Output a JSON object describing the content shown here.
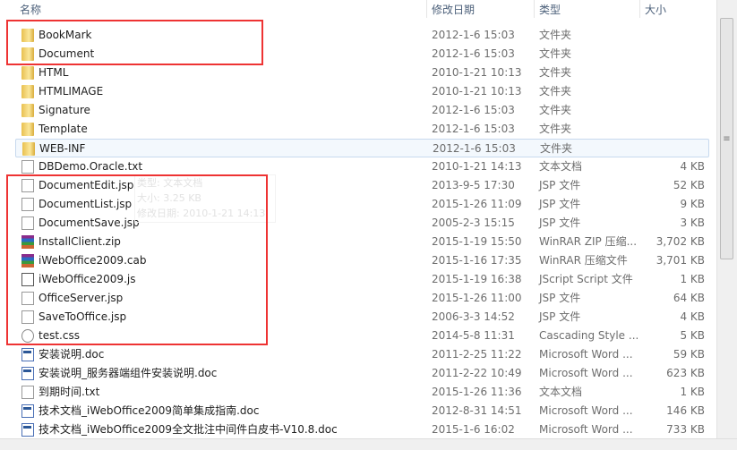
{
  "columns": {
    "name": "名称",
    "date": "修改日期",
    "type": "类型",
    "size": "大小"
  },
  "tooltip": {
    "type": "类型: 文本文档",
    "size": "大小: 3.25 KB",
    "date": "修改日期: 2010-1-21 14:13"
  },
  "highlight_color": "#ee3333",
  "files": [
    {
      "icon": "folder",
      "name": "BookMark",
      "date": "2012-1-6 15:03",
      "type": "文件夹",
      "size": ""
    },
    {
      "icon": "folder",
      "name": "Document",
      "date": "2012-1-6 15:03",
      "type": "文件夹",
      "size": ""
    },
    {
      "icon": "folder",
      "name": "HTML",
      "date": "2010-1-21 10:13",
      "type": "文件夹",
      "size": ""
    },
    {
      "icon": "folder",
      "name": "HTMLIMAGE",
      "date": "2010-1-21 10:13",
      "type": "文件夹",
      "size": ""
    },
    {
      "icon": "folder",
      "name": "Signature",
      "date": "2012-1-6 15:03",
      "type": "文件夹",
      "size": ""
    },
    {
      "icon": "folder",
      "name": "Template",
      "date": "2012-1-6 15:03",
      "type": "文件夹",
      "size": ""
    },
    {
      "icon": "folder",
      "name": "WEB-INF",
      "date": "2012-1-6 15:03",
      "type": "文件夹",
      "size": "",
      "selected": true
    },
    {
      "icon": "file",
      "name": "DBDemo.Oracle.txt",
      "date": "2010-1-21 14:13",
      "type": "文本文档",
      "size": "4 KB"
    },
    {
      "icon": "file",
      "name": "DocumentEdit.jsp",
      "date": "2013-9-5 17:30",
      "type": "JSP 文件",
      "size": "52 KB"
    },
    {
      "icon": "file",
      "name": "DocumentList.jsp",
      "date": "2015-1-26 11:09",
      "type": "JSP 文件",
      "size": "9 KB"
    },
    {
      "icon": "file",
      "name": "DocumentSave.jsp",
      "date": "2005-2-3 15:15",
      "type": "JSP 文件",
      "size": "3 KB"
    },
    {
      "icon": "zip",
      "name": "InstallClient.zip",
      "date": "2015-1-19 15:50",
      "type": "WinRAR ZIP 压缩...",
      "size": "3,702 KB"
    },
    {
      "icon": "zip",
      "name": "iWebOffice2009.cab",
      "date": "2015-1-16 17:35",
      "type": "WinRAR 压缩文件",
      "size": "3,701 KB"
    },
    {
      "icon": "js",
      "name": "iWebOffice2009.js",
      "date": "2015-1-19 16:38",
      "type": "JScript Script 文件",
      "size": "1 KB"
    },
    {
      "icon": "file",
      "name": "OfficeServer.jsp",
      "date": "2015-1-26 11:00",
      "type": "JSP 文件",
      "size": "64 KB"
    },
    {
      "icon": "file",
      "name": "SaveToOffice.jsp",
      "date": "2006-3-3 14:52",
      "type": "JSP 文件",
      "size": "4 KB"
    },
    {
      "icon": "css",
      "name": "test.css",
      "date": "2014-5-8 11:31",
      "type": "Cascading Style ...",
      "size": "5 KB"
    },
    {
      "icon": "doc",
      "name": "安装说明.doc",
      "date": "2011-2-25 11:22",
      "type": "Microsoft Word ...",
      "size": "59 KB"
    },
    {
      "icon": "doc",
      "name": "安装说明_服务器端组件安装说明.doc",
      "date": "2011-2-22 10:49",
      "type": "Microsoft Word ...",
      "size": "623 KB"
    },
    {
      "icon": "file",
      "name": "到期时间.txt",
      "date": "2015-1-26 11:36",
      "type": "文本文档",
      "size": "1 KB"
    },
    {
      "icon": "doc",
      "name": "技术文档_iWebOffice2009简单集成指南.doc",
      "date": "2012-8-31 14:51",
      "type": "Microsoft Word ...",
      "size": "146 KB"
    },
    {
      "icon": "doc",
      "name": "技术文档_iWebOffice2009全文批注中间件白皮书-V10.8.doc",
      "date": "2015-1-6 16:02",
      "type": "Microsoft Word ...",
      "size": "733 KB"
    }
  ]
}
